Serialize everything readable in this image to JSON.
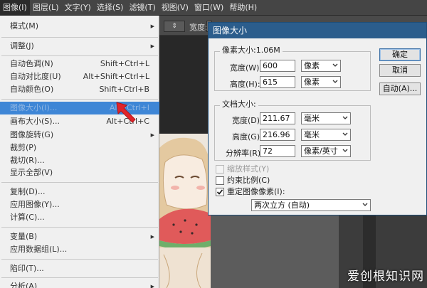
{
  "menubar": {
    "items": [
      "图像(I)",
      "图层(L)",
      "文字(Y)",
      "选择(S)",
      "滤镜(T)",
      "视图(V)",
      "窗口(W)",
      "帮助(H)"
    ]
  },
  "options_bar": {
    "width_label": "宽度:"
  },
  "image_menu": {
    "items": [
      {
        "label": "模式(M)",
        "submenu": true
      },
      {
        "label": "调整(J)",
        "submenu": true
      },
      {
        "label": "自动色调(N)",
        "shortcut": "Shift+Ctrl+L"
      },
      {
        "label": "自动对比度(U)",
        "shortcut": "Alt+Shift+Ctrl+L"
      },
      {
        "label": "自动颜色(O)",
        "shortcut": "Shift+Ctrl+B"
      },
      {
        "label": "图像大小(I)...",
        "shortcut": "Alt+Ctrl+I"
      },
      {
        "label": "画布大小(S)...",
        "shortcut": "Alt+Ctrl+C"
      },
      {
        "label": "图像旋转(G)",
        "submenu": true
      },
      {
        "label": "裁剪(P)"
      },
      {
        "label": "裁切(R)..."
      },
      {
        "label": "显示全部(V)"
      },
      {
        "label": "复制(D)..."
      },
      {
        "label": "应用图像(Y)..."
      },
      {
        "label": "计算(C)..."
      },
      {
        "label": "变量(B)",
        "submenu": true
      },
      {
        "label": "应用数据组(L)..."
      },
      {
        "label": "陷印(T)..."
      },
      {
        "label": "分析(A)",
        "submenu": true
      }
    ]
  },
  "dialog": {
    "title": "图像大小",
    "pixel_dimensions": {
      "title": "像素大小:1.06M",
      "width_label": "宽度(W):",
      "width_value": "600",
      "width_unit": "像素",
      "height_label": "高度(H):",
      "height_value": "615",
      "height_unit": "像素"
    },
    "document_size": {
      "title": "文档大小:",
      "width_label": "宽度(D):",
      "width_value": "211.67",
      "width_unit": "毫米",
      "height_label": "高度(G):",
      "height_value": "216.96",
      "height_unit": "毫米",
      "resolution_label": "分辨率(R):",
      "resolution_value": "72",
      "resolution_unit": "像素/英寸"
    },
    "scale_styles": "缩放样式(Y)",
    "constrain": "约束比例(C)",
    "resample": "重定图像像素(I):",
    "resample_method": "两次立方 (自动)",
    "ok": "确定",
    "cancel": "取消",
    "auto": "自动(A)..."
  },
  "watermark": "爱创根知识网",
  "colors": {
    "menu_highlight": "#3e86d6",
    "dialog_title_bar": "#2b5d8c",
    "arrow_red": "#e0242a"
  }
}
